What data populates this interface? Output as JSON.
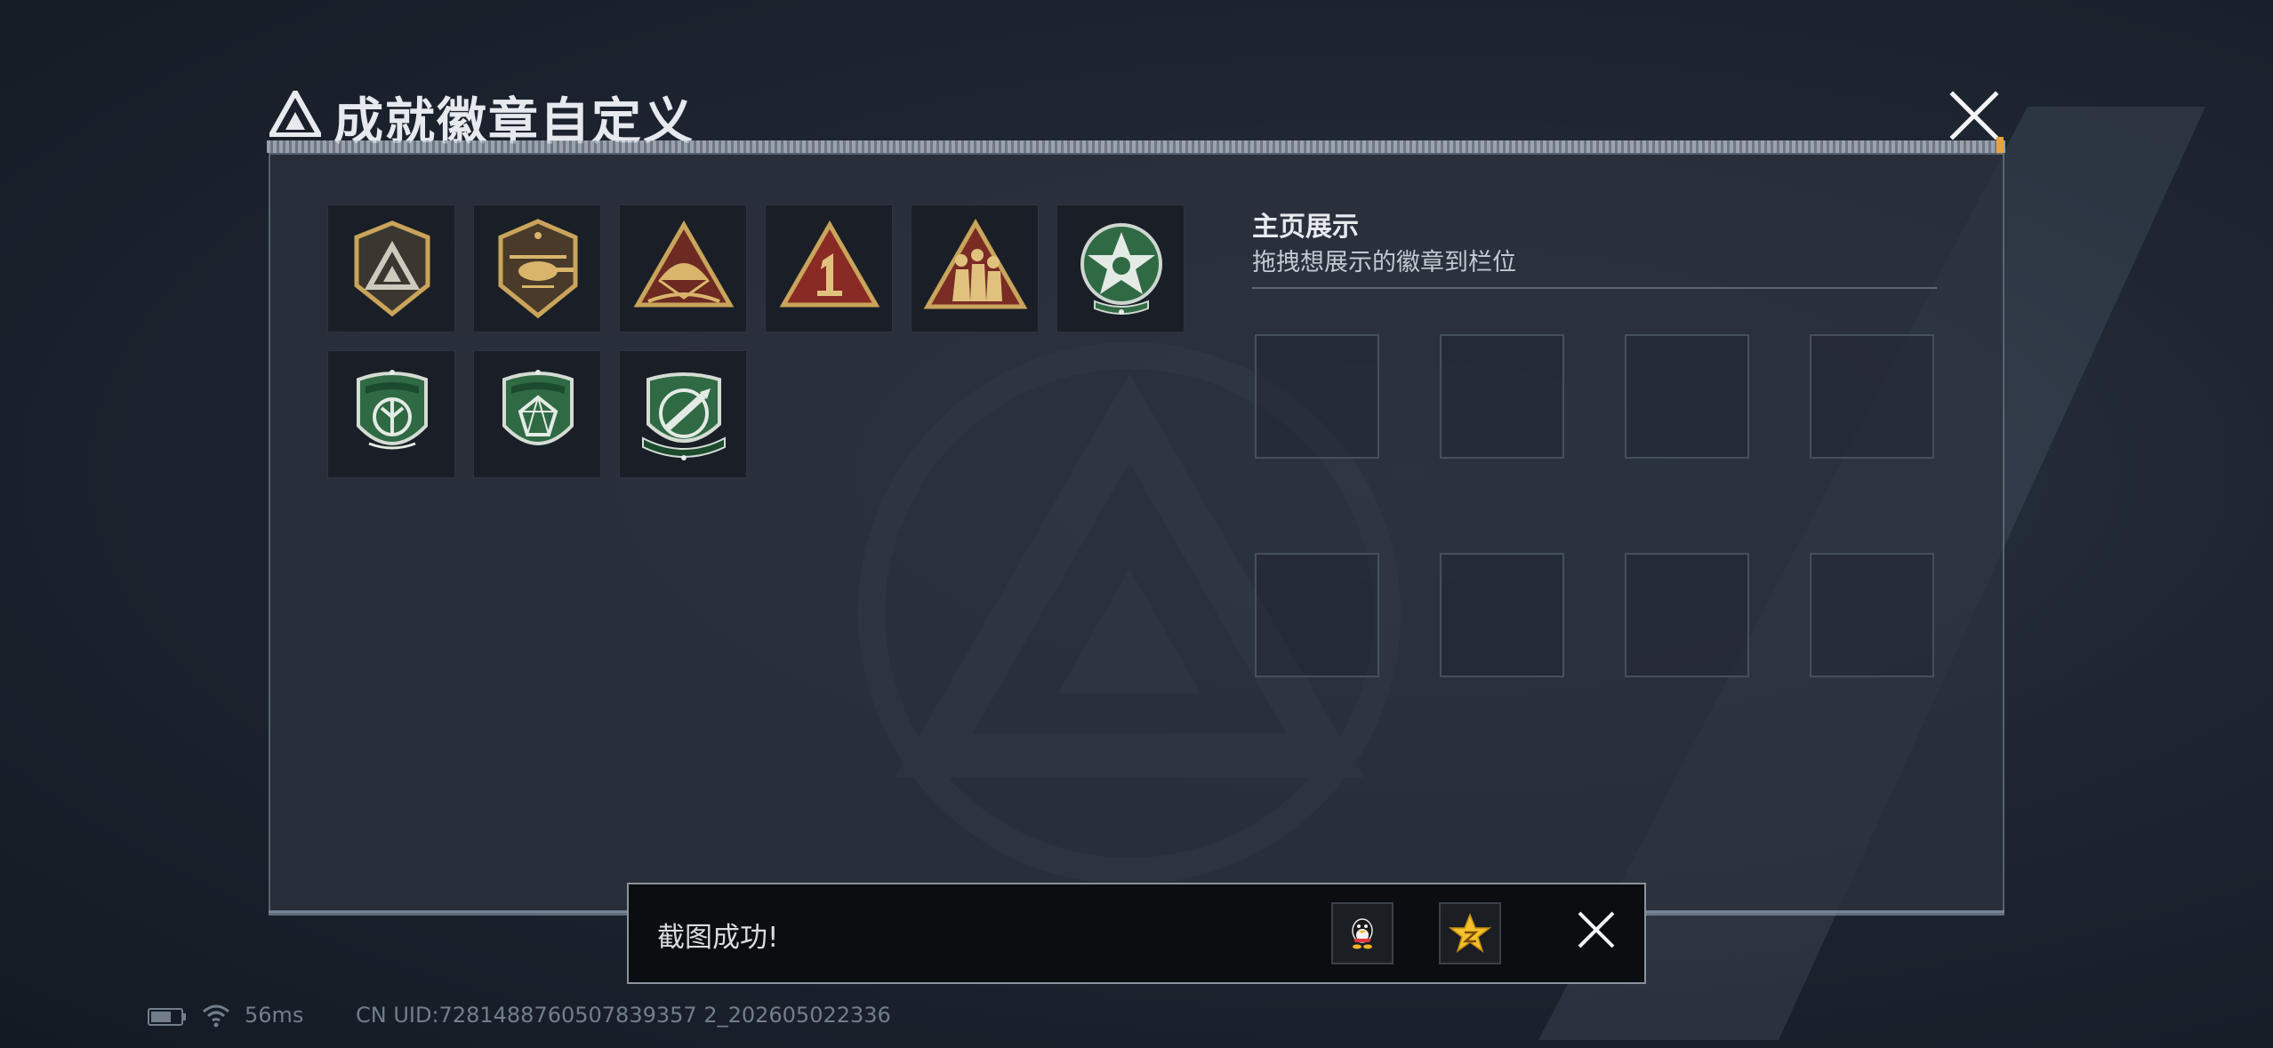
{
  "window": {
    "title": "成就徽章自定义",
    "title_tick": ""
  },
  "badges": [
    {
      "icon": "triangle-logo-shield-badge-icon"
    },
    {
      "icon": "helicopter-shield-badge-icon"
    },
    {
      "icon": "parachute-triangle-badge-icon"
    },
    {
      "icon": "number-one-triangle-badge-icon"
    },
    {
      "icon": "soldiers-triangle-badge-icon"
    },
    {
      "icon": "green-star-medal-badge-icon"
    },
    {
      "icon": "green-shield-emblem-badge-icon"
    },
    {
      "icon": "green-shield-gem-badge-icon"
    },
    {
      "icon": "green-crosshair-badge-icon"
    }
  ],
  "display": {
    "title": "主页展示",
    "subtitle": "拖拽想展示的徽章到栏位"
  },
  "toast": {
    "message": "截图成功!",
    "share_qq_icon": "qq-penguin-icon",
    "share_qzone_icon": "qzone-star-icon"
  },
  "status_bar": {
    "ping": "56ms",
    "uid": "CN UID:7281488760507839357 2_202605022336"
  },
  "colors": {
    "gold": "#c9a45a",
    "red": "#8a2a25",
    "green": "#2f6a45",
    "panel": "#2b323d"
  }
}
